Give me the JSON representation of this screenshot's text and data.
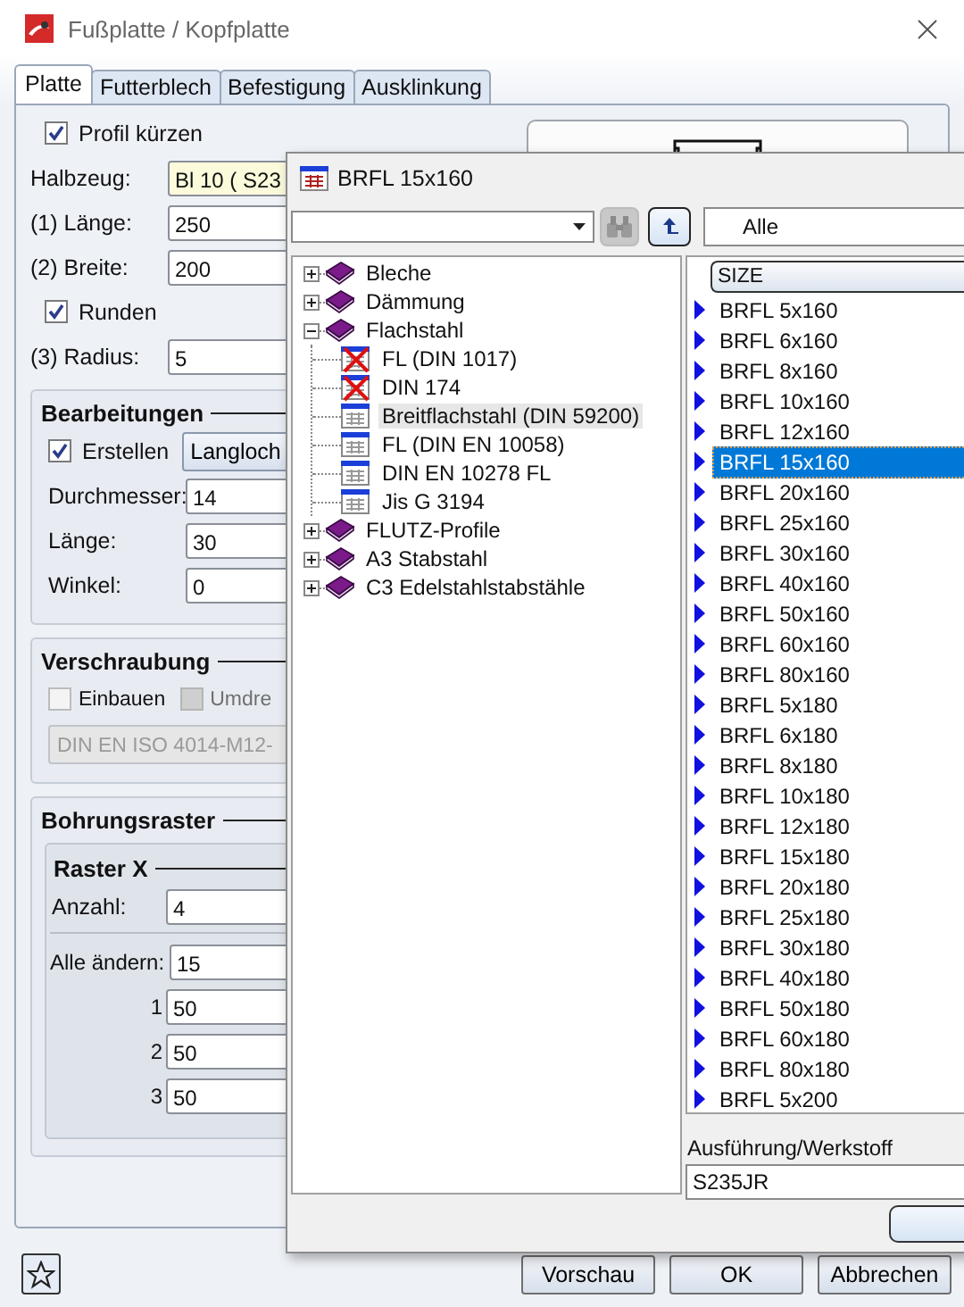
{
  "window": {
    "title": "Fußplatte / Kopfplatte"
  },
  "tabs": [
    {
      "label": "Platte",
      "selected": true
    },
    {
      "label": "Futterblech",
      "selected": false
    },
    {
      "label": "Befestigung",
      "selected": false
    },
    {
      "label": "Ausklinkung",
      "selected": false
    }
  ],
  "rows": [
    {
      "kind": "checkbox",
      "label": "Profil kürzen",
      "checked": true
    },
    {
      "kind": "field",
      "label": "Halbzeug:",
      "value": "Bl 10  ( S23",
      "highlighted": true
    },
    {
      "kind": "field",
      "label": "(1) Länge:",
      "value": "250",
      "highlighted": false
    },
    {
      "kind": "field",
      "label": "(2) Breite:",
      "value": "200",
      "highlighted": false
    },
    {
      "kind": "checkbox",
      "label": "Runden",
      "checked": true
    },
    {
      "kind": "field",
      "label": "(3) Radius:",
      "value": "5",
      "highlighted": false
    }
  ],
  "bearbeitungen": {
    "title": "Bearbeitungen",
    "create": {
      "label": "Erstellen",
      "checked": true
    },
    "type_button": "Langloch",
    "fields": [
      {
        "label": "Durchmesser:",
        "value": "14"
      },
      {
        "label": "Länge:",
        "value": "30"
      },
      {
        "label": "Winkel:",
        "value": "0"
      }
    ]
  },
  "verschraubung": {
    "title": "Verschraubung",
    "options": [
      {
        "label": "Einbauen",
        "checked": false,
        "disabled": false
      },
      {
        "label": "Umdre",
        "checked": false,
        "disabled": true
      }
    ],
    "screw": {
      "value": "DIN EN ISO 4014-M12-",
      "disabled": true
    }
  },
  "bohrungsraster": {
    "title": "Bohrungsraster",
    "raster_x": {
      "title": "Raster X",
      "count": {
        "label": "Anzahl:",
        "value": "4"
      },
      "all": {
        "label": "Alle ändern:",
        "value": "15"
      },
      "rows": [
        {
          "label": "1",
          "value": "50"
        },
        {
          "label": "2",
          "value": "50"
        },
        {
          "label": "3",
          "value": "50"
        }
      ]
    }
  },
  "footer": {
    "buttons": [
      "Vorschau",
      "OK",
      "Abbrechen"
    ]
  },
  "popup": {
    "title": "BRFL 15x160",
    "filter": "Alle",
    "tree": [
      {
        "label": "Bleche",
        "kind": "folder",
        "expanded": false,
        "selected": false
      },
      {
        "label": "Dämmung",
        "kind": "folder",
        "expanded": false,
        "selected": false
      },
      {
        "label": "Flachstahl",
        "kind": "folder",
        "expanded": true,
        "selected": false,
        "children": [
          {
            "label": "FL (DIN 1017)",
            "kind": "table",
            "crossed": true,
            "selected": false
          },
          {
            "label": "DIN 174",
            "kind": "table",
            "crossed": true,
            "selected": false
          },
          {
            "label": "Breitflachstahl (DIN 59200)",
            "kind": "table",
            "crossed": false,
            "selected": true
          },
          {
            "label": "FL (DIN EN 10058)",
            "kind": "table",
            "crossed": false,
            "selected": false
          },
          {
            "label": "DIN EN 10278 FL",
            "kind": "table",
            "crossed": false,
            "selected": false
          },
          {
            "label": "Jis G 3194",
            "kind": "table",
            "crossed": false,
            "selected": false
          }
        ]
      },
      {
        "label": "FLUTZ-Profile",
        "kind": "folder",
        "expanded": false,
        "selected": false
      },
      {
        "label": "A3 Stabstahl",
        "kind": "folder",
        "expanded": false,
        "selected": false
      },
      {
        "label": "C3 Edelstahlstabstähle",
        "kind": "folder",
        "expanded": false,
        "selected": false
      }
    ],
    "list": {
      "header": "SIZE",
      "items": [
        {
          "label": "BRFL 5x160",
          "selected": false
        },
        {
          "label": "BRFL 6x160",
          "selected": false
        },
        {
          "label": "BRFL 8x160",
          "selected": false
        },
        {
          "label": "BRFL 10x160",
          "selected": false
        },
        {
          "label": "BRFL 12x160",
          "selected": false
        },
        {
          "label": "BRFL 15x160",
          "selected": true
        },
        {
          "label": "BRFL 20x160",
          "selected": false
        },
        {
          "label": "BRFL 25x160",
          "selected": false
        },
        {
          "label": "BRFL 30x160",
          "selected": false
        },
        {
          "label": "BRFL 40x160",
          "selected": false
        },
        {
          "label": "BRFL 50x160",
          "selected": false
        },
        {
          "label": "BRFL 60x160",
          "selected": false
        },
        {
          "label": "BRFL 80x160",
          "selected": false
        },
        {
          "label": "BRFL 5x180",
          "selected": false
        },
        {
          "label": "BRFL 6x180",
          "selected": false
        },
        {
          "label": "BRFL 8x180",
          "selected": false
        },
        {
          "label": "BRFL 10x180",
          "selected": false
        },
        {
          "label": "BRFL 12x180",
          "selected": false
        },
        {
          "label": "BRFL 15x180",
          "selected": false
        },
        {
          "label": "BRFL 20x180",
          "selected": false
        },
        {
          "label": "BRFL 25x180",
          "selected": false
        },
        {
          "label": "BRFL 30x180",
          "selected": false
        },
        {
          "label": "BRFL 40x180",
          "selected": false
        },
        {
          "label": "BRFL 50x180",
          "selected": false
        },
        {
          "label": "BRFL 60x180",
          "selected": false
        },
        {
          "label": "BRFL 80x180",
          "selected": false
        },
        {
          "label": "BRFL 5x200",
          "selected": false
        }
      ]
    },
    "material": {
      "label": "Ausführung/Werkstoff",
      "value": "S235JR"
    }
  }
}
